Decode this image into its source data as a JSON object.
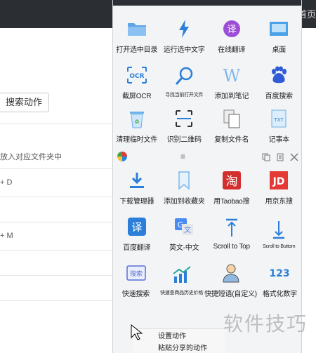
{
  "background": {
    "nav_home": "首页",
    "search_button": "搜索动作",
    "row_text_1": "放入对应文件夹中",
    "row_text_2": "+ D",
    "row_text_3": "+ M"
  },
  "panel": {
    "row1": [
      {
        "label": "打开选中目录",
        "icon": "folder-icon"
      },
      {
        "label": "运行选中文字",
        "icon": "lightning-icon"
      },
      {
        "label": "在线翻译",
        "icon": "translate-icon"
      },
      {
        "label": "桌面",
        "icon": "desktop-icon"
      }
    ],
    "row2": [
      {
        "label": "截屏OCR",
        "icon": "ocr-icon"
      },
      {
        "label": "寻找当前打开文件",
        "icon": "magnifier-icon"
      },
      {
        "label": "添加到笔记",
        "icon": "note-w-icon"
      },
      {
        "label": "百度搜索",
        "icon": "baidu-icon"
      }
    ],
    "row3": [
      {
        "label": "清理临时文件",
        "icon": "recycle-bin-icon"
      },
      {
        "label": "识别二维码",
        "icon": "qr-scan-icon"
      },
      {
        "label": "复制文件名",
        "icon": "copy-file-icon"
      },
      {
        "label": "记事本",
        "icon": "notepad-icon"
      }
    ],
    "toolbar": {
      "middle": "≡"
    },
    "row4": [
      {
        "label": "下载管理器",
        "icon": "download-icon"
      },
      {
        "label": "添加到收藏夹",
        "icon": "bookmark-icon"
      },
      {
        "label": "用Taobao搜",
        "icon": "taobao-icon"
      },
      {
        "label": "用京东搜",
        "icon": "jd-icon"
      }
    ],
    "row5": [
      {
        "label": "百度翻译",
        "icon": "baidu-translate-icon"
      },
      {
        "label": "英文-中文",
        "icon": "google-translate-icon"
      },
      {
        "label": "Scroll to Top",
        "icon": "scroll-top-icon"
      },
      {
        "label": "Scroll to Buttom",
        "icon": "scroll-bottom-icon"
      }
    ],
    "row6": [
      {
        "label": "快速搜索",
        "icon": "quick-search-icon"
      },
      {
        "label": "快速查商品历史价格",
        "icon": "price-chart-icon"
      },
      {
        "label": "快捷短语(自定义)",
        "icon": "person-phrase-icon"
      },
      {
        "label": "格式化数字",
        "icon": "number-123-icon"
      }
    ]
  },
  "context_menu": {
    "item1": "设置动作",
    "item2": "粘贴分享的动作"
  },
  "watermark": "软件技巧",
  "colors": {
    "blue": "#2b7fd8",
    "red": "#d32f2f",
    "panel_bg": "#f3f4f6"
  }
}
